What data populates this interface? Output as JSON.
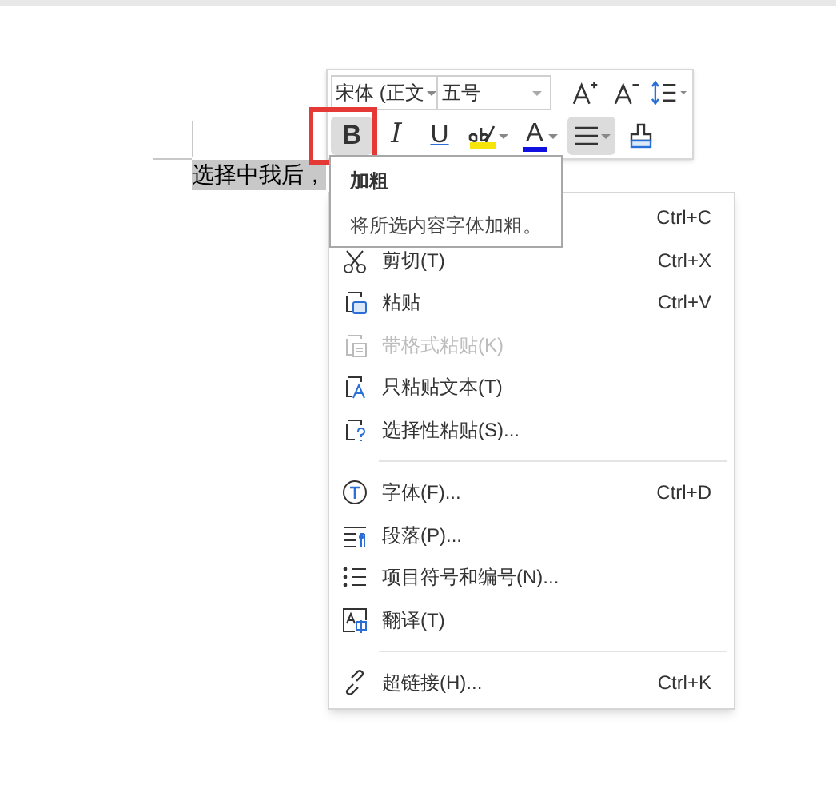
{
  "document": {
    "selected_text": "选择中我后，"
  },
  "toolbar": {
    "font_name": "宋体 (正文",
    "font_size": "五号",
    "buttons": [
      {
        "kind": "bold",
        "label": "B",
        "selected": true
      },
      {
        "kind": "italic",
        "label": "I",
        "selected": false
      },
      {
        "kind": "underline",
        "label": "U",
        "selected": false
      },
      {
        "kind": "highlight",
        "selected": false
      },
      {
        "kind": "color",
        "label": "A",
        "selected": false
      },
      {
        "kind": "align",
        "selected": true
      },
      {
        "kind": "painter",
        "selected": false
      }
    ]
  },
  "tooltip": {
    "title": "加粗",
    "text": "将所选内容字体加粗。"
  },
  "context_menu": {
    "items": [
      {
        "kind": "copy",
        "shortcut": "Ctrl+C",
        "disabled": false
      },
      {
        "kind": "cut",
        "label": "剪切(T)",
        "shortcut": "Ctrl+X",
        "disabled": false
      },
      {
        "kind": "paste",
        "label": "粘贴",
        "shortcut": "Ctrl+V",
        "disabled": false
      },
      {
        "kind": "paste-format",
        "label": "带格式粘贴(K)",
        "disabled": true
      },
      {
        "kind": "paste-text",
        "label": "只粘贴文本(T)",
        "disabled": false
      },
      {
        "kind": "paste-special",
        "label": "选择性粘贴(S)...",
        "disabled": false
      },
      {
        "kind": "separator"
      },
      {
        "kind": "font",
        "label": "字体(F)...",
        "shortcut": "Ctrl+D",
        "disabled": false
      },
      {
        "kind": "paragraph",
        "label": "段落(P)...",
        "disabled": false
      },
      {
        "kind": "bullets",
        "label": "项目符号和编号(N)...",
        "disabled": false
      },
      {
        "kind": "translate",
        "label": "翻译(T)",
        "disabled": false
      },
      {
        "kind": "separator"
      },
      {
        "kind": "link",
        "label": "超链接(H)...",
        "shortcut": "Ctrl+K",
        "disabled": false
      }
    ]
  }
}
